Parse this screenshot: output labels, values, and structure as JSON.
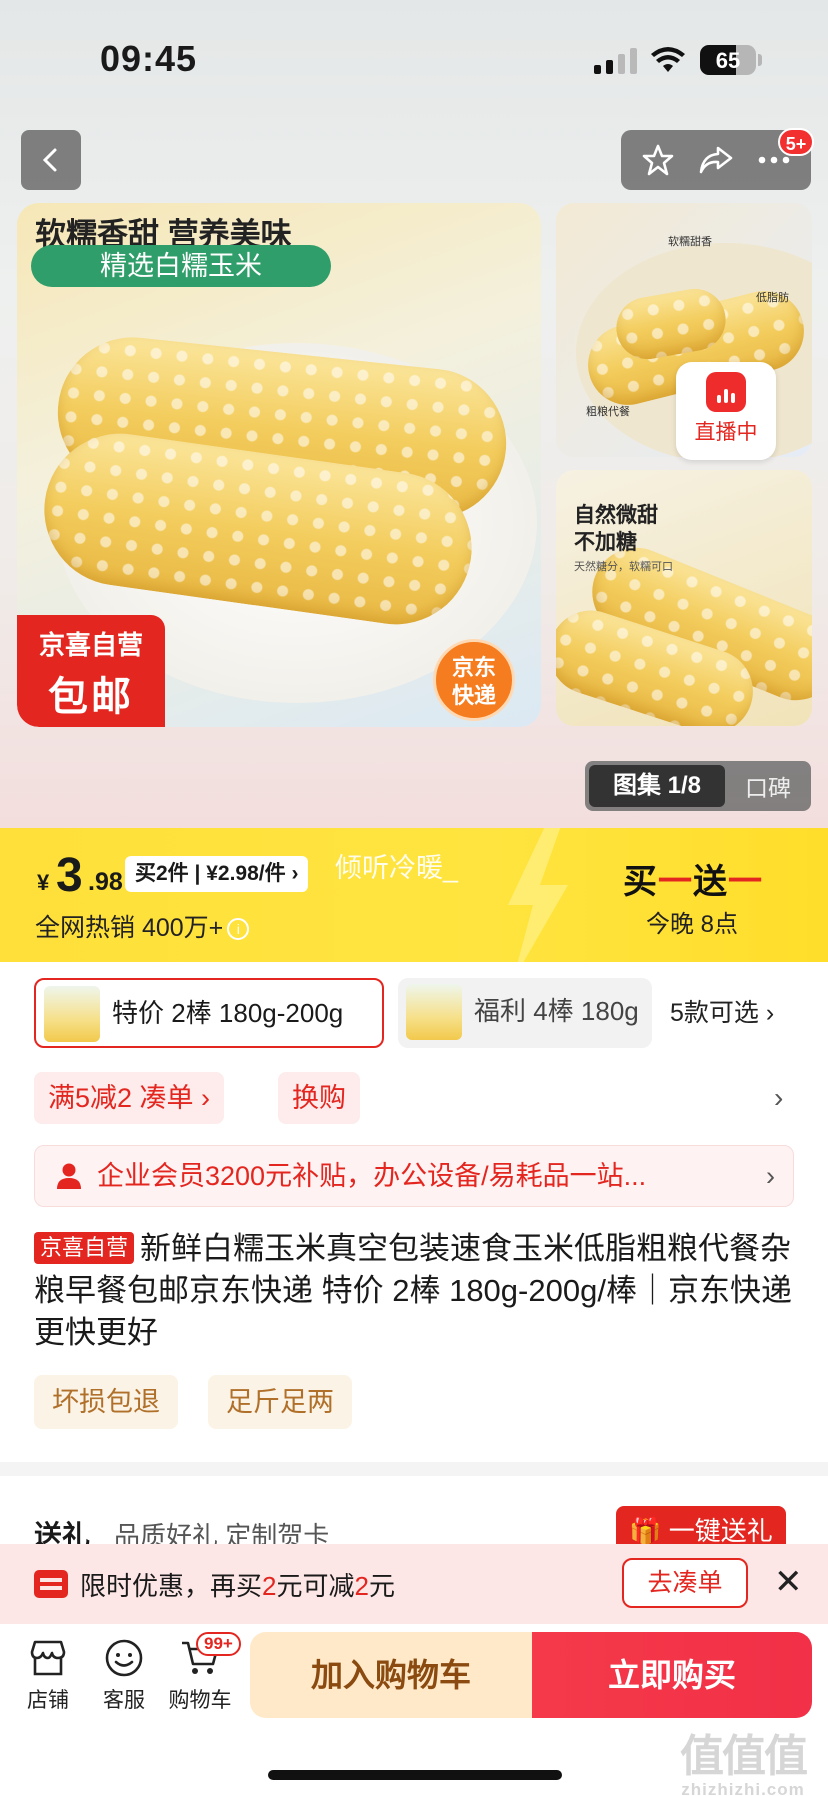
{
  "status": {
    "time": "09:45",
    "battery": "65"
  },
  "nav": {
    "more_badge": "5+"
  },
  "hero": {
    "main_title": "软糯香甜 营养美味",
    "main_tag": "精选白糯玉米",
    "badge_line1": "京喜自营",
    "badge_line2": "包邮",
    "express_line1": "京东",
    "express_line2": "快递",
    "side1_labels": [
      "软糯甜香",
      "低脂肪",
      "粗粮代餐"
    ],
    "live_label": "直播中",
    "side2_title_1": "自然微甜",
    "side2_title_2": "不加糖",
    "side2_sub": "天然糖分，软糯可口"
  },
  "gallery": {
    "active": "图集 1/8",
    "other": "口碑"
  },
  "price": {
    "currency": "¥",
    "integer": "3",
    "decimal": ".98",
    "multi_buy": "买2件 | ¥2.98/件 ›",
    "overlay_text": "倾听冷暖_",
    "hot_sales": "全网热销 400万+",
    "promo_prefix": "买",
    "promo_dash1": "一",
    "promo_mid": "送",
    "promo_dash2": "一",
    "promo_time": "今晚 8点"
  },
  "sku": {
    "option1": "特价 2棒 180g-200g",
    "option2": "福利 4棒 180g",
    "more": "5款可选 ›"
  },
  "promos": {
    "full_reduction": "满5减2 凑单 ›",
    "exchange": "换购",
    "member": "企业会员3200元补贴，办公设备/易耗品一站..."
  },
  "product": {
    "tag": "京喜自营",
    "title": "新鲜白糯玉米真空包装速食玉米低脂粗粮代餐杂粮早餐包邮京东快递 特价 2棒 180g-200g/棒｜京东快递 更快更好"
  },
  "services": [
    "坏损包退",
    "足斤足两"
  ],
  "gift": {
    "label": "送礼",
    "desc": "品质好礼 定制贺卡",
    "button": "一键送礼"
  },
  "offer": {
    "text_a": "限时优惠，再买",
    "amount1": "2",
    "text_b": "元可减",
    "amount2": "2",
    "text_c": "元",
    "button": "去凑单"
  },
  "bottom": {
    "store": "店铺",
    "service": "客服",
    "cart": "购物车",
    "cart_badge": "99+",
    "add_to_cart": "加入购物车",
    "buy_now": "立即购买"
  },
  "watermark": {
    "main": "值值值",
    "sub": "zhizhizhi.com"
  },
  "colors": {
    "accent_red": "#e3261f",
    "price_band": "#ffe03a",
    "green_tag": "#2f9e6a"
  }
}
